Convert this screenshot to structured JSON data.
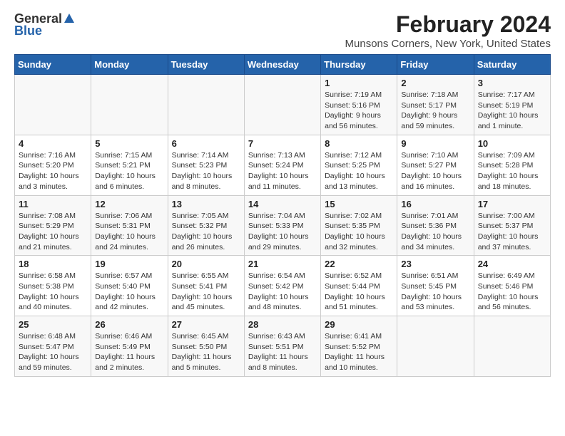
{
  "logo": {
    "general": "General",
    "blue": "Blue"
  },
  "title": "February 2024",
  "subtitle": "Munsons Corners, New York, United States",
  "headers": [
    "Sunday",
    "Monday",
    "Tuesday",
    "Wednesday",
    "Thursday",
    "Friday",
    "Saturday"
  ],
  "weeks": [
    [
      {
        "day": "",
        "info": ""
      },
      {
        "day": "",
        "info": ""
      },
      {
        "day": "",
        "info": ""
      },
      {
        "day": "",
        "info": ""
      },
      {
        "day": "1",
        "info": "Sunrise: 7:19 AM\nSunset: 5:16 PM\nDaylight: 9 hours and 56 minutes."
      },
      {
        "day": "2",
        "info": "Sunrise: 7:18 AM\nSunset: 5:17 PM\nDaylight: 9 hours and 59 minutes."
      },
      {
        "day": "3",
        "info": "Sunrise: 7:17 AM\nSunset: 5:19 PM\nDaylight: 10 hours and 1 minute."
      }
    ],
    [
      {
        "day": "4",
        "info": "Sunrise: 7:16 AM\nSunset: 5:20 PM\nDaylight: 10 hours and 3 minutes."
      },
      {
        "day": "5",
        "info": "Sunrise: 7:15 AM\nSunset: 5:21 PM\nDaylight: 10 hours and 6 minutes."
      },
      {
        "day": "6",
        "info": "Sunrise: 7:14 AM\nSunset: 5:23 PM\nDaylight: 10 hours and 8 minutes."
      },
      {
        "day": "7",
        "info": "Sunrise: 7:13 AM\nSunset: 5:24 PM\nDaylight: 10 hours and 11 minutes."
      },
      {
        "day": "8",
        "info": "Sunrise: 7:12 AM\nSunset: 5:25 PM\nDaylight: 10 hours and 13 minutes."
      },
      {
        "day": "9",
        "info": "Sunrise: 7:10 AM\nSunset: 5:27 PM\nDaylight: 10 hours and 16 minutes."
      },
      {
        "day": "10",
        "info": "Sunrise: 7:09 AM\nSunset: 5:28 PM\nDaylight: 10 hours and 18 minutes."
      }
    ],
    [
      {
        "day": "11",
        "info": "Sunrise: 7:08 AM\nSunset: 5:29 PM\nDaylight: 10 hours and 21 minutes."
      },
      {
        "day": "12",
        "info": "Sunrise: 7:06 AM\nSunset: 5:31 PM\nDaylight: 10 hours and 24 minutes."
      },
      {
        "day": "13",
        "info": "Sunrise: 7:05 AM\nSunset: 5:32 PM\nDaylight: 10 hours and 26 minutes."
      },
      {
        "day": "14",
        "info": "Sunrise: 7:04 AM\nSunset: 5:33 PM\nDaylight: 10 hours and 29 minutes."
      },
      {
        "day": "15",
        "info": "Sunrise: 7:02 AM\nSunset: 5:35 PM\nDaylight: 10 hours and 32 minutes."
      },
      {
        "day": "16",
        "info": "Sunrise: 7:01 AM\nSunset: 5:36 PM\nDaylight: 10 hours and 34 minutes."
      },
      {
        "day": "17",
        "info": "Sunrise: 7:00 AM\nSunset: 5:37 PM\nDaylight: 10 hours and 37 minutes."
      }
    ],
    [
      {
        "day": "18",
        "info": "Sunrise: 6:58 AM\nSunset: 5:38 PM\nDaylight: 10 hours and 40 minutes."
      },
      {
        "day": "19",
        "info": "Sunrise: 6:57 AM\nSunset: 5:40 PM\nDaylight: 10 hours and 42 minutes."
      },
      {
        "day": "20",
        "info": "Sunrise: 6:55 AM\nSunset: 5:41 PM\nDaylight: 10 hours and 45 minutes."
      },
      {
        "day": "21",
        "info": "Sunrise: 6:54 AM\nSunset: 5:42 PM\nDaylight: 10 hours and 48 minutes."
      },
      {
        "day": "22",
        "info": "Sunrise: 6:52 AM\nSunset: 5:44 PM\nDaylight: 10 hours and 51 minutes."
      },
      {
        "day": "23",
        "info": "Sunrise: 6:51 AM\nSunset: 5:45 PM\nDaylight: 10 hours and 53 minutes."
      },
      {
        "day": "24",
        "info": "Sunrise: 6:49 AM\nSunset: 5:46 PM\nDaylight: 10 hours and 56 minutes."
      }
    ],
    [
      {
        "day": "25",
        "info": "Sunrise: 6:48 AM\nSunset: 5:47 PM\nDaylight: 10 hours and 59 minutes."
      },
      {
        "day": "26",
        "info": "Sunrise: 6:46 AM\nSunset: 5:49 PM\nDaylight: 11 hours and 2 minutes."
      },
      {
        "day": "27",
        "info": "Sunrise: 6:45 AM\nSunset: 5:50 PM\nDaylight: 11 hours and 5 minutes."
      },
      {
        "day": "28",
        "info": "Sunrise: 6:43 AM\nSunset: 5:51 PM\nDaylight: 11 hours and 8 minutes."
      },
      {
        "day": "29",
        "info": "Sunrise: 6:41 AM\nSunset: 5:52 PM\nDaylight: 11 hours and 10 minutes."
      },
      {
        "day": "",
        "info": ""
      },
      {
        "day": "",
        "info": ""
      }
    ]
  ]
}
